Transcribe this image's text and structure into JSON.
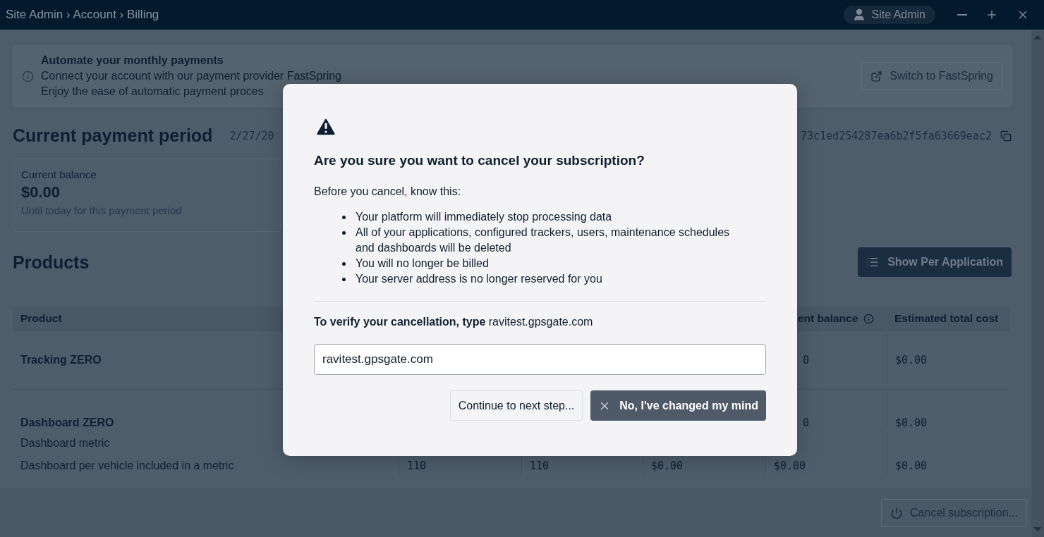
{
  "title_bar": {
    "breadcrumb": "Site Admin › Account › Billing",
    "user": "Site Admin"
  },
  "banner": {
    "title": "Automate your monthly payments",
    "lines": [
      "Connect your account with our payment provider FastSpring",
      "Enjoy the ease of automatic payment proces"
    ],
    "button": "Switch to FastSpring"
  },
  "payment_period": {
    "title": "Current payment period",
    "dates": "2/27/20",
    "hash": "73c1ed254287ea6b2f5fa63669eac2"
  },
  "balance_card": {
    "label": "Current balance",
    "amount": "$0.00",
    "note": "Until today for this payment period"
  },
  "products": {
    "title": "Products",
    "button": "Show Per Application"
  },
  "table": {
    "columns": [
      "Product",
      "",
      "",
      "",
      "ent balance",
      "Estimated total cost"
    ],
    "rows": [
      {
        "kind": "group",
        "cells": [
          "Tracking ZERO",
          "",
          "",
          "",
          "0",
          "$0.00"
        ]
      },
      {
        "kind": "group",
        "cells": [
          "Dashboard ZERO",
          "",
          "",
          "",
          "0",
          "$0.00"
        ]
      },
      {
        "kind": "item",
        "cells": [
          "Dashboard metric",
          "",
          "",
          "",
          "",
          ""
        ]
      },
      {
        "kind": "item",
        "cells": [
          "Dashboard per vehicle included in a metric",
          "110",
          "110",
          "$0.00",
          "$0.00",
          "$0.00"
        ]
      }
    ]
  },
  "footer": {
    "button": "Cancel subscription..."
  },
  "dialog": {
    "title": "Are you sure you want to cancel your subscription?",
    "intro": "Before you cancel, know this:",
    "points": [
      "Your platform will immediately stop processing data",
      "All of your applications, configured trackers, users, maintenance schedules and dashboards will be deleted",
      "You will no longer be billed",
      "Your server address is no longer reserved for you"
    ],
    "verify": "**To verify your cancellation, type** ravitest.gpsgate.com",
    "input_value": "ravitest.gpsgate.com",
    "buttons": [
      {
        "kind": "secondary",
        "label": "Continue to next step..."
      },
      {
        "kind": "primary",
        "label": "No, I've changed my mind"
      }
    ]
  }
}
